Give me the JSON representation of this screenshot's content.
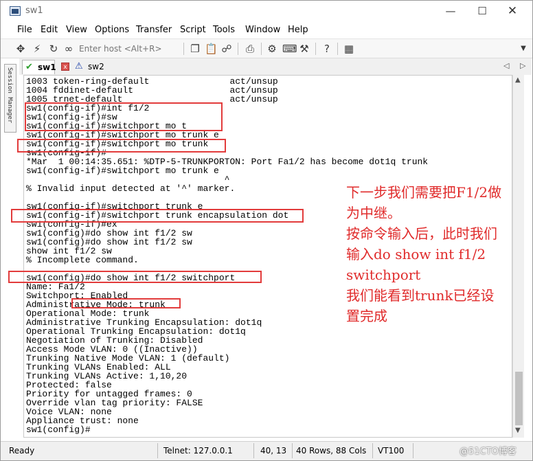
{
  "window": {
    "title": "sw1"
  },
  "menu": [
    "File",
    "Edit",
    "View",
    "Options",
    "Transfer",
    "Script",
    "Tools",
    "Window",
    "Help"
  ],
  "toolbar": {
    "host_placeholder": "Enter host <Alt+R>"
  },
  "session_manager_label": "Session Manager",
  "tabs": [
    {
      "label": "sw1",
      "status": "connected",
      "active": true
    },
    {
      "label": "sw2",
      "status": "warning",
      "active": false
    }
  ],
  "tab_close_glyph": "x",
  "terminal": {
    "lines": [
      "1003 token-ring-default               act/unsup",
      "1004 fddinet-default                  act/unsup",
      "1005 trnet-default                    act/unsup",
      "sw1(config-if)#int f1/2",
      "sw1(config-if)#sw",
      "sw1(config-if)#switchport mo t",
      "sw1(config-if)#switchport mo trunk e",
      "sw1(config-if)#switchport mo trunk",
      "sw1(config-if)#",
      "*Mar  1 00:14:35.651: %DTP-5-TRUNKPORTON: Port Fa1/2 has become dot1q trunk",
      "sw1(config-if)#switchport mo trunk e",
      "                                     ^",
      "% Invalid input detected at '^' marker.",
      "",
      "sw1(config-if)#switchport trunk e",
      "sw1(config-if)#switchport trunk encapsulation dot",
      "sw1(config-if)#ex",
      "sw1(config)#do show int f1/2 sw",
      "sw1(config)#do show int f1/2 sw",
      "show int f1/2 sw",
      "% Incomplete command.",
      "",
      "sw1(config)#do show int f1/2 switchport",
      "Name: Fa1/2",
      "Switchport: Enabled",
      "Administrative Mode: trunk",
      "Operational Mode: trunk",
      "Administrative Trunking Encapsulation: dot1q",
      "Operational Trunking Encapsulation: dot1q",
      "Negotiation of Trunking: Disabled",
      "Access Mode VLAN: 0 ((Inactive))",
      "Trunking Native Mode VLAN: 1 (default)",
      "Trunking VLANs Enabled: ALL",
      "Trunking VLANs Active: 1,10,20",
      "Protected: false",
      "Priority for untagged frames: 0",
      "Override vlan tag priority: FALSE",
      "Voice VLAN: none",
      "Appliance trust: none",
      "sw1(config)#"
    ]
  },
  "annotation": {
    "lines": [
      "下一步我们需要把F1/2做",
      "为中继。",
      "按命令输入后，此时我们",
      "输入do show int f1/2",
      "switchport",
      "我们能看到trunk已经设",
      "置完成"
    ],
    "color": "#e02b2b"
  },
  "statusbar": {
    "ready": "Ready",
    "connection": "Telnet: 127.0.0.1",
    "cursor": "40, 13",
    "size": "40 Rows, 88 Cols",
    "emulation": "VT100",
    "watermark": "@51CTO博客"
  },
  "colors": {
    "highlight": "#e23b3b",
    "tab_ok": "#2e9e2e",
    "tab_warn": "#1a3fa8"
  }
}
